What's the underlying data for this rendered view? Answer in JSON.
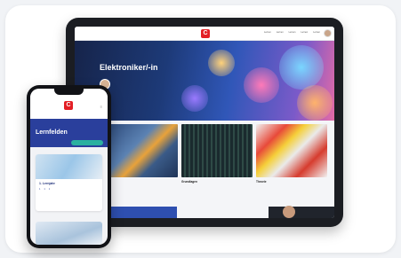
{
  "tablet": {
    "nav_links": [
      "Lernen",
      "Lernen",
      "Lernen",
      "Lernen",
      "Lernen"
    ],
    "hero_title": "Elektroniker/-in",
    "author_name": "",
    "cards": [
      {
        "label": ""
      },
      {
        "label": "Grundlagen"
      },
      {
        "label": "Theorie"
      }
    ]
  },
  "phone": {
    "breadcrumb": "",
    "title": "Lernfelden",
    "action_label": "",
    "card": {
      "title": "1. Lernjahr",
      "text": "",
      "meta": [
        "1",
        "1",
        "1"
      ]
    }
  },
  "colors": {
    "brand_red": "#e31e24",
    "primary_blue": "#2a3f9c",
    "accent_teal": "#2bb0a0"
  }
}
